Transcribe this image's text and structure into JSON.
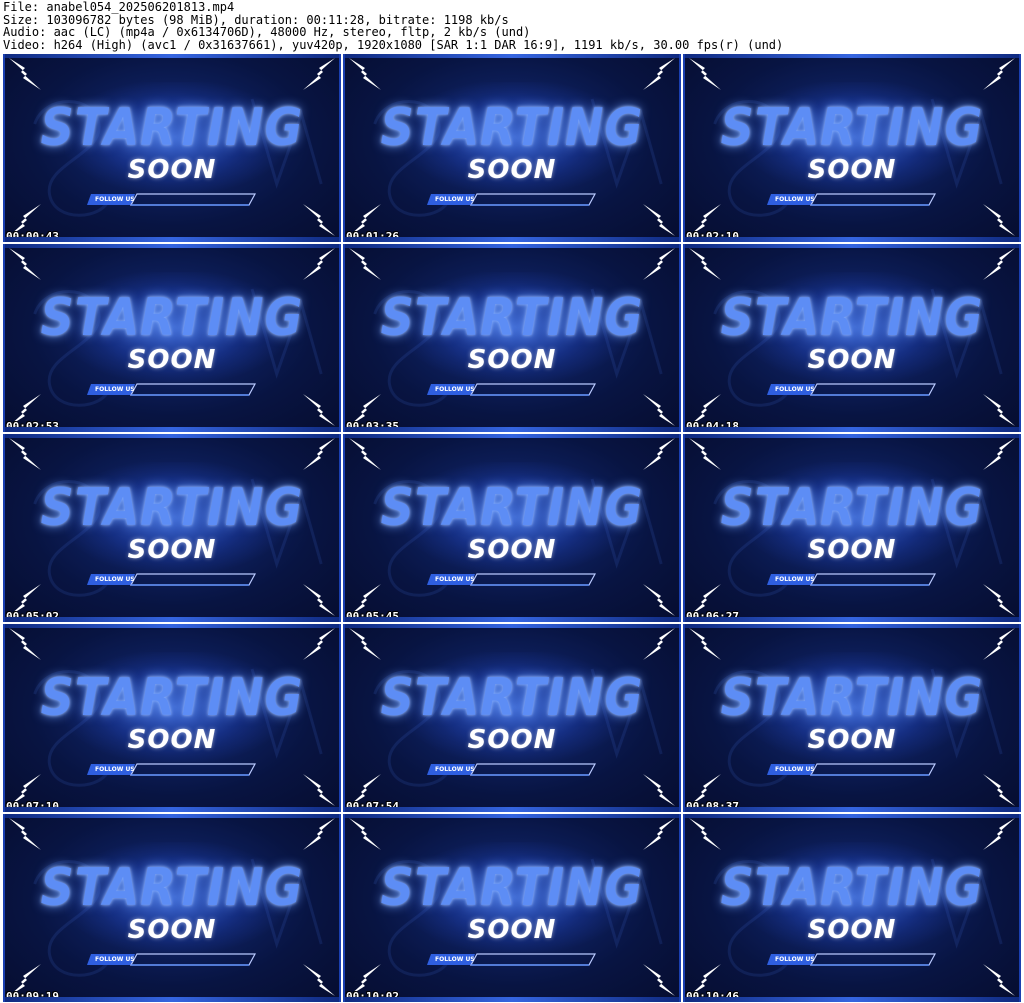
{
  "header": {
    "line1": "File: anabel054_202506201813.mp4",
    "line2": "Size: 103096782 bytes (98 MiB), duration: 00:11:28, bitrate: 1198 kb/s",
    "line3": "Audio: aac (LC) (mp4a / 0x6134706D), 48000 Hz, stereo, fltp, 2 kb/s (und)",
    "line4": "Video: h264 (High) (avc1 / 0x31637661), yuv420p, 1920x1080 [SAR 1:1 DAR 16:9], 1191 kb/s, 30.00 fps(r) (und)"
  },
  "frame": {
    "title": "STARTING",
    "subtitle": "SOON",
    "follow_label": "FOLLOW US"
  },
  "thumbnails": [
    {
      "timestamp": "00:00:43"
    },
    {
      "timestamp": "00:01:26"
    },
    {
      "timestamp": "00:02:10"
    },
    {
      "timestamp": "00:02:53"
    },
    {
      "timestamp": "00:03:35"
    },
    {
      "timestamp": "00:04:18"
    },
    {
      "timestamp": "00:05:02"
    },
    {
      "timestamp": "00:05:45"
    },
    {
      "timestamp": "00:06:27"
    },
    {
      "timestamp": "00:07:10"
    },
    {
      "timestamp": "00:07:54"
    },
    {
      "timestamp": "00:08:37"
    },
    {
      "timestamp": "00:09:19"
    },
    {
      "timestamp": "00:10:02"
    },
    {
      "timestamp": "00:10:46"
    }
  ],
  "colors": {
    "background": "#081442",
    "accent": "#3565e0",
    "title": "#5d8df5"
  }
}
